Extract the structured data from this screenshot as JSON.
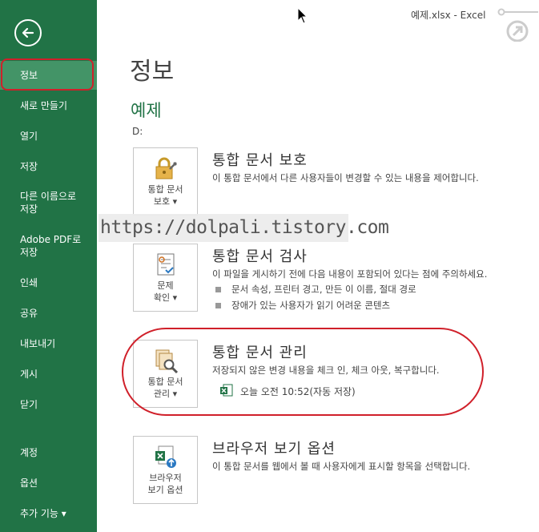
{
  "window": {
    "title": "예제.xlsx - Excel"
  },
  "sidebar": {
    "back_icon": "back-arrow-icon",
    "items": [
      {
        "label": "정보",
        "active": true
      },
      {
        "label": "새로 만들기"
      },
      {
        "label": "열기"
      },
      {
        "label": "저장"
      },
      {
        "label": "다른 이름으로 저장"
      },
      {
        "label": "Adobe PDF로 저장"
      },
      {
        "label": "인쇄"
      },
      {
        "label": "공유"
      },
      {
        "label": "내보내기"
      },
      {
        "label": "게시"
      },
      {
        "label": "닫기"
      },
      {
        "label": "계정"
      },
      {
        "label": "옵션"
      },
      {
        "label": "추가 기능 ▾"
      }
    ],
    "colors": {
      "background": "#217346",
      "active": "#439467",
      "highlight": "#d0202a"
    }
  },
  "main": {
    "title": "정보",
    "doc_name": "예제",
    "doc_path": "D:",
    "watermark": "https://dolpali.tistory.com",
    "sections": [
      {
        "tile_label_1": "통합 문서",
        "tile_label_2": "보호 ▾",
        "icon": "lock-icon",
        "title": "통합 문서 보호",
        "desc": "이 통합 문서에서 다른 사용자들이 변경할 수 있는 내용을 제어합니다."
      },
      {
        "tile_label_1": "문제",
        "tile_label_2": "확인 ▾",
        "icon": "inspect-document-icon",
        "title": "통합 문서 검사",
        "desc": "이 파일을 게시하기 전에 다음 내용이 포함되어 있다는 점에 주의하세요.",
        "bullets": [
          "문서 속성, 프린터 경고, 만든 이 이름, 절대 경로",
          "장애가 있는 사용자가 읽기 어려운 콘텐츠"
        ]
      },
      {
        "tile_label_1": "통합 문서",
        "tile_label_2": "관리 ▾",
        "icon": "manage-workbook-icon",
        "title": "통합 문서 관리",
        "desc": "저장되지 않은 변경 내용을 체크 인, 체크 아웃, 복구합니다.",
        "version": "오늘 오전 10:52(자동 저장)"
      },
      {
        "tile_label_1": "브라우저",
        "tile_label_2": "보기 옵션",
        "icon": "browser-view-icon",
        "title": "브라우저 보기 옵션",
        "desc": "이 통합 문서를 웹에서 볼 때 사용자에게 표시할 항목을 선택합니다."
      }
    ]
  }
}
